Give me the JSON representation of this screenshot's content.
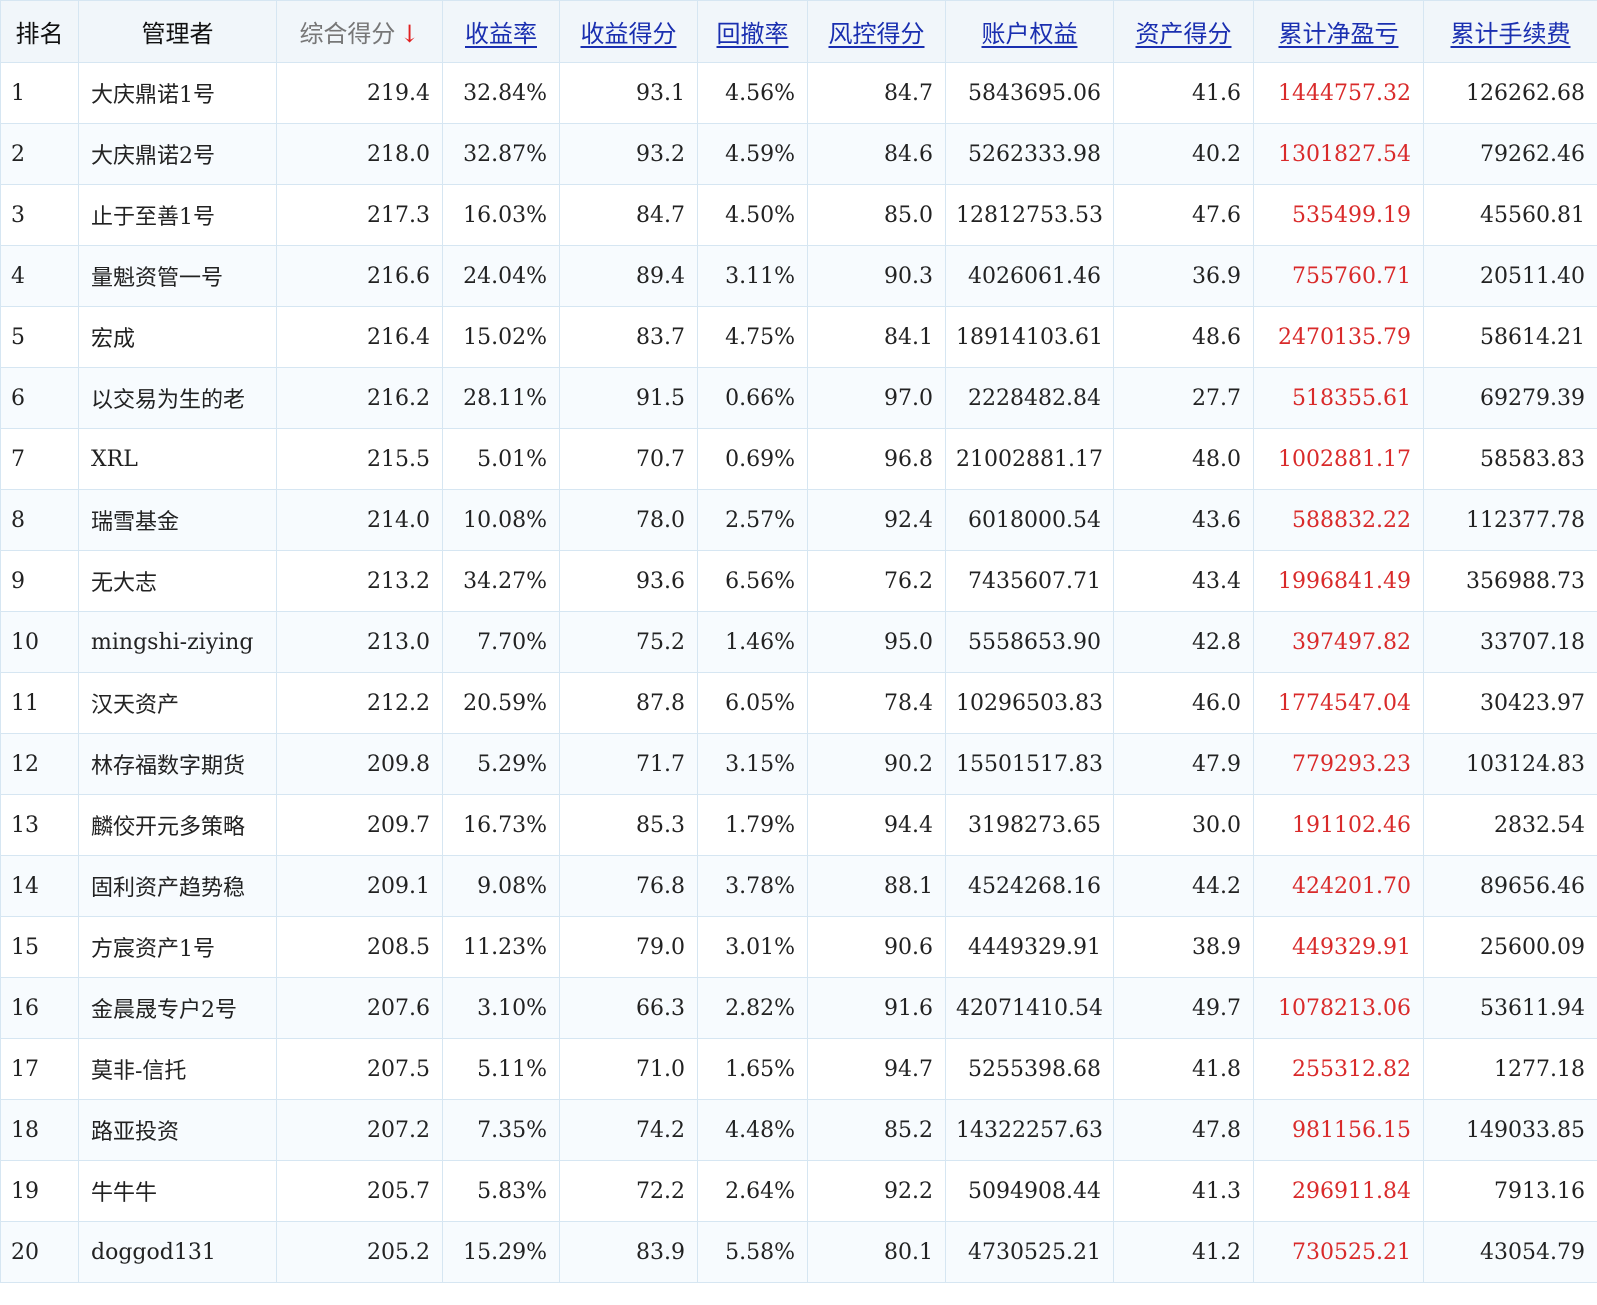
{
  "columns": [
    {
      "key": "rank",
      "label": "排名",
      "kind": "plain"
    },
    {
      "key": "manager",
      "label": "管理者",
      "kind": "plain"
    },
    {
      "key": "score",
      "label": "综合得分",
      "kind": "sorted",
      "sort_icon": "arrow-down-icon",
      "sort_glyph": "↓"
    },
    {
      "key": "return_rate",
      "label": "收益率",
      "kind": "link"
    },
    {
      "key": "return_score",
      "label": "收益得分",
      "kind": "link"
    },
    {
      "key": "drawdown",
      "label": "回撤率",
      "kind": "link"
    },
    {
      "key": "risk_score",
      "label": "风控得分",
      "kind": "link"
    },
    {
      "key": "equity",
      "label": "账户权益",
      "kind": "link"
    },
    {
      "key": "asset_score",
      "label": "资产得分",
      "kind": "link"
    },
    {
      "key": "net_pnl",
      "label": "累计净盈亏",
      "kind": "link"
    },
    {
      "key": "fees",
      "label": "累计手续费",
      "kind": "link"
    }
  ],
  "colors": {
    "pnl": "#d92a2a",
    "header_link": "#1a2fb0",
    "sort_arrow": "#e02020",
    "header_bg": "#f1f6fa",
    "border": "#d6e6f2"
  },
  "rows": [
    {
      "rank": "1",
      "manager": "大庆鼎诺1号",
      "score": "219.4",
      "return_rate": "32.84%",
      "return_score": "93.1",
      "drawdown": "4.56%",
      "risk_score": "84.7",
      "equity": "5843695.06",
      "asset_score": "41.6",
      "net_pnl": "1444757.32",
      "fees": "126262.68"
    },
    {
      "rank": "2",
      "manager": "大庆鼎诺2号",
      "score": "218.0",
      "return_rate": "32.87%",
      "return_score": "93.2",
      "drawdown": "4.59%",
      "risk_score": "84.6",
      "equity": "5262333.98",
      "asset_score": "40.2",
      "net_pnl": "1301827.54",
      "fees": "79262.46"
    },
    {
      "rank": "3",
      "manager": "止于至善1号",
      "score": "217.3",
      "return_rate": "16.03%",
      "return_score": "84.7",
      "drawdown": "4.50%",
      "risk_score": "85.0",
      "equity": "12812753.53",
      "asset_score": "47.6",
      "net_pnl": "535499.19",
      "fees": "45560.81"
    },
    {
      "rank": "4",
      "manager": "量魁资管一号",
      "score": "216.6",
      "return_rate": "24.04%",
      "return_score": "89.4",
      "drawdown": "3.11%",
      "risk_score": "90.3",
      "equity": "4026061.46",
      "asset_score": "36.9",
      "net_pnl": "755760.71",
      "fees": "20511.40"
    },
    {
      "rank": "5",
      "manager": "宏成",
      "score": "216.4",
      "return_rate": "15.02%",
      "return_score": "83.7",
      "drawdown": "4.75%",
      "risk_score": "84.1",
      "equity": "18914103.61",
      "asset_score": "48.6",
      "net_pnl": "2470135.79",
      "fees": "58614.21"
    },
    {
      "rank": "6",
      "manager": "以交易为生的老",
      "score": "216.2",
      "return_rate": "28.11%",
      "return_score": "91.5",
      "drawdown": "0.66%",
      "risk_score": "97.0",
      "equity": "2228482.84",
      "asset_score": "27.7",
      "net_pnl": "518355.61",
      "fees": "69279.39"
    },
    {
      "rank": "7",
      "manager": "XRL",
      "score": "215.5",
      "return_rate": "5.01%",
      "return_score": "70.7",
      "drawdown": "0.69%",
      "risk_score": "96.8",
      "equity": "21002881.17",
      "asset_score": "48.0",
      "net_pnl": "1002881.17",
      "fees": "58583.83"
    },
    {
      "rank": "8",
      "manager": "瑞雪基金",
      "score": "214.0",
      "return_rate": "10.08%",
      "return_score": "78.0",
      "drawdown": "2.57%",
      "risk_score": "92.4",
      "equity": "6018000.54",
      "asset_score": "43.6",
      "net_pnl": "588832.22",
      "fees": "112377.78"
    },
    {
      "rank": "9",
      "manager": "无大志",
      "score": "213.2",
      "return_rate": "34.27%",
      "return_score": "93.6",
      "drawdown": "6.56%",
      "risk_score": "76.2",
      "equity": "7435607.71",
      "asset_score": "43.4",
      "net_pnl": "1996841.49",
      "fees": "356988.73"
    },
    {
      "rank": "10",
      "manager": "mingshi-ziying",
      "score": "213.0",
      "return_rate": "7.70%",
      "return_score": "75.2",
      "drawdown": "1.46%",
      "risk_score": "95.0",
      "equity": "5558653.90",
      "asset_score": "42.8",
      "net_pnl": "397497.82",
      "fees": "33707.18"
    },
    {
      "rank": "11",
      "manager": "汉天资产",
      "score": "212.2",
      "return_rate": "20.59%",
      "return_score": "87.8",
      "drawdown": "6.05%",
      "risk_score": "78.4",
      "equity": "10296503.83",
      "asset_score": "46.0",
      "net_pnl": "1774547.04",
      "fees": "30423.97"
    },
    {
      "rank": "12",
      "manager": "林存福数字期货",
      "score": "209.8",
      "return_rate": "5.29%",
      "return_score": "71.7",
      "drawdown": "3.15%",
      "risk_score": "90.2",
      "equity": "15501517.83",
      "asset_score": "47.9",
      "net_pnl": "779293.23",
      "fees": "103124.83"
    },
    {
      "rank": "13",
      "manager": "麟佼开元多策略",
      "score": "209.7",
      "return_rate": "16.73%",
      "return_score": "85.3",
      "drawdown": "1.79%",
      "risk_score": "94.4",
      "equity": "3198273.65",
      "asset_score": "30.0",
      "net_pnl": "191102.46",
      "fees": "2832.54"
    },
    {
      "rank": "14",
      "manager": "固利资产趋势稳",
      "score": "209.1",
      "return_rate": "9.08%",
      "return_score": "76.8",
      "drawdown": "3.78%",
      "risk_score": "88.1",
      "equity": "4524268.16",
      "asset_score": "44.2",
      "net_pnl": "424201.70",
      "fees": "89656.46"
    },
    {
      "rank": "15",
      "manager": "方宸资产1号",
      "score": "208.5",
      "return_rate": "11.23%",
      "return_score": "79.0",
      "drawdown": "3.01%",
      "risk_score": "90.6",
      "equity": "4449329.91",
      "asset_score": "38.9",
      "net_pnl": "449329.91",
      "fees": "25600.09"
    },
    {
      "rank": "16",
      "manager": "金晨晟专户2号",
      "score": "207.6",
      "return_rate": "3.10%",
      "return_score": "66.3",
      "drawdown": "2.82%",
      "risk_score": "91.6",
      "equity": "42071410.54",
      "asset_score": "49.7",
      "net_pnl": "1078213.06",
      "fees": "53611.94"
    },
    {
      "rank": "17",
      "manager": "莫非-信托",
      "score": "207.5",
      "return_rate": "5.11%",
      "return_score": "71.0",
      "drawdown": "1.65%",
      "risk_score": "94.7",
      "equity": "5255398.68",
      "asset_score": "41.8",
      "net_pnl": "255312.82",
      "fees": "1277.18"
    },
    {
      "rank": "18",
      "manager": "路亚投资",
      "score": "207.2",
      "return_rate": "7.35%",
      "return_score": "74.2",
      "drawdown": "4.48%",
      "risk_score": "85.2",
      "equity": "14322257.63",
      "asset_score": "47.8",
      "net_pnl": "981156.15",
      "fees": "149033.85"
    },
    {
      "rank": "19",
      "manager": "牛牛牛",
      "score": "205.7",
      "return_rate": "5.83%",
      "return_score": "72.2",
      "drawdown": "2.64%",
      "risk_score": "92.2",
      "equity": "5094908.44",
      "asset_score": "41.3",
      "net_pnl": "296911.84",
      "fees": "7913.16"
    },
    {
      "rank": "20",
      "manager": "doggod131",
      "score": "205.2",
      "return_rate": "15.29%",
      "return_score": "83.9",
      "drawdown": "5.58%",
      "risk_score": "80.1",
      "equity": "4730525.21",
      "asset_score": "41.2",
      "net_pnl": "730525.21",
      "fees": "43054.79"
    }
  ]
}
